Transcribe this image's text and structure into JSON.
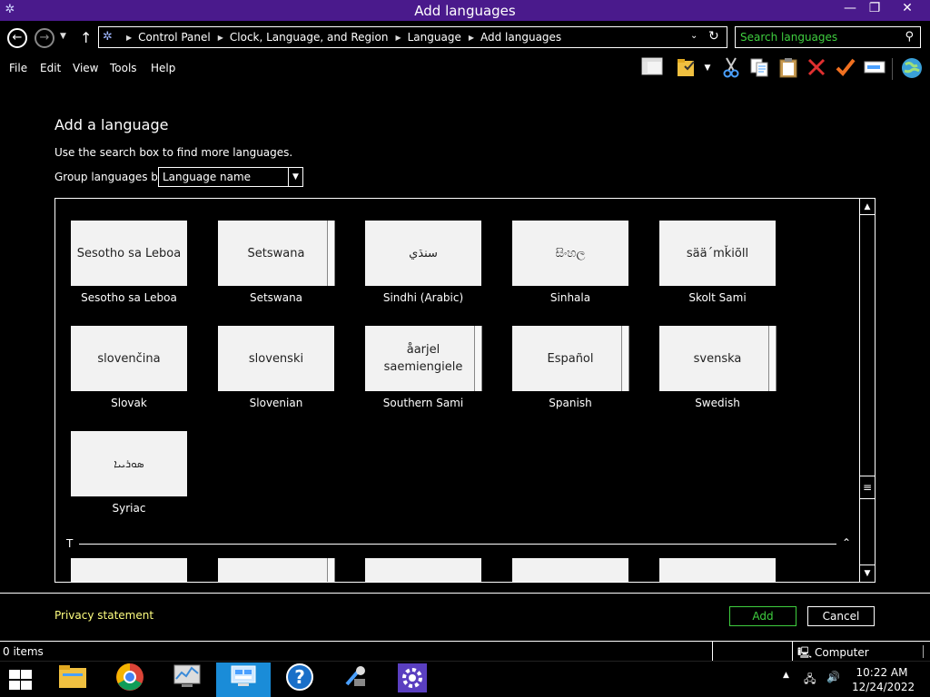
{
  "window": {
    "title": "Add languages",
    "app_icon": "control-panel-icon",
    "controls": {
      "minimize": "—",
      "maximize": "❐",
      "close": "✕"
    }
  },
  "nav": {
    "back_icon": "arrow-left-icon",
    "forward_icon": "arrow-right-icon",
    "breadcrumbs": [
      "Control Panel",
      "Clock, Language, and Region",
      "Language",
      "Add languages"
    ],
    "search_placeholder": "Search languages"
  },
  "menu": [
    "File",
    "Edit",
    "View",
    "Tools",
    "Help"
  ],
  "toolbar": {
    "icons": [
      "pane-icon",
      "folder-check-icon",
      "dropdown-icon",
      "cut-icon",
      "copy-icon",
      "paste-icon",
      "delete-icon",
      "checkmark-icon",
      "rename-icon",
      "globe-icon"
    ],
    "colors": {
      "delete": "#e03030",
      "check": "#f07020",
      "cut": "#4aa0ff",
      "folder": "#f0c040"
    }
  },
  "page": {
    "heading": "Add a language",
    "hint": "Use the search box to find more languages.",
    "group_label": "Group languages by:",
    "group_value": "Language name"
  },
  "languages": [
    {
      "native": "Sesotho sa Leboa",
      "name": "Sesotho sa Leboa"
    },
    {
      "native": "Setswana",
      "name": "Setswana"
    },
    {
      "native": "سنڌي",
      "name": "Sindhi (Arabic)"
    },
    {
      "native": "සිංහල",
      "name": "Sinhala"
    },
    {
      "native": "sää´mǩiõll",
      "name": "Skolt Sami"
    },
    {
      "native": "slovenčina",
      "name": "Slovak"
    },
    {
      "native": "slovenski",
      "name": "Slovenian"
    },
    {
      "native": "åarjel saemiengiele",
      "name": "Southern Sami"
    },
    {
      "native": "Español",
      "name": "Spanish"
    },
    {
      "native": "svenska",
      "name": "Swedish"
    },
    {
      "native": "ܣܘܪܝܝܐ",
      "name": "Syriac"
    }
  ],
  "section": {
    "letter": "T"
  },
  "footer": {
    "privacy": "Privacy statement",
    "add": "Add",
    "cancel": "Cancel"
  },
  "status": {
    "items": "0 items",
    "zone": "Computer"
  },
  "taskbar": {
    "apps": [
      "file-explorer-icon",
      "chrome-icon",
      "task-manager-icon",
      "control-panel-icon",
      "help-icon",
      "tools-icon",
      "settings-icon"
    ],
    "active_app": "control-panel-icon",
    "time": "10:22 AM",
    "date": "12/24/2022"
  },
  "colors": {
    "titlebar": "#4a1a8c",
    "accent_green": "#3fcf3f",
    "link_yellow": "#ffff80",
    "taskbar_active": "#1a8cd8"
  }
}
